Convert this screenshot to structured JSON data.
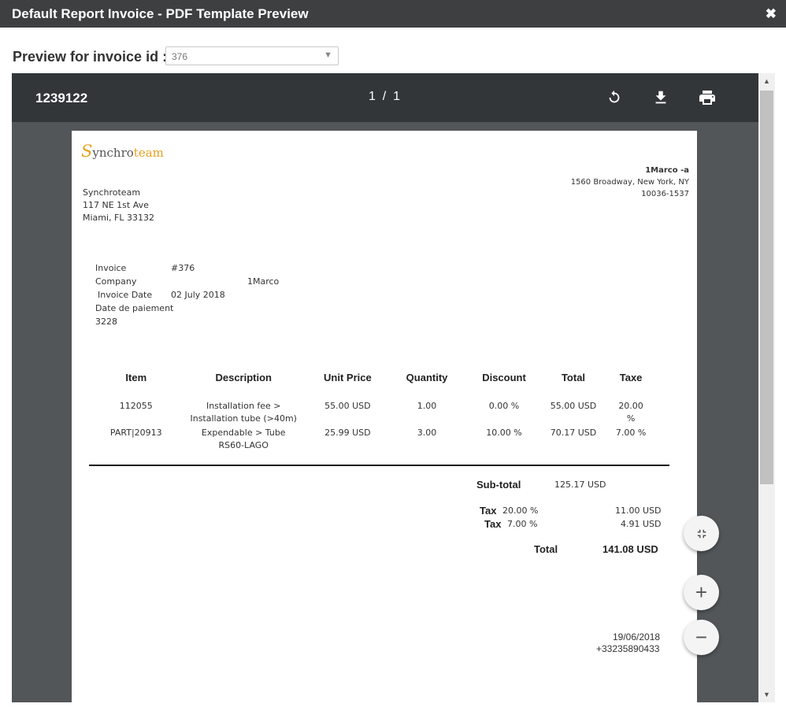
{
  "dialog": {
    "title": "Default Report Invoice - PDF Template Preview",
    "close_glyph": "✖"
  },
  "selector": {
    "label": "Preview for invoice id :",
    "value": "376"
  },
  "viewer": {
    "doc_name": "1239122",
    "page_current": "1",
    "page_sep": "/",
    "page_total": "1",
    "icons": [
      "rotate-icon",
      "download-icon",
      "print-icon"
    ]
  },
  "invoice": {
    "logo_first": "S",
    "logo_mid": "ynchro",
    "logo_end": "team",
    "client": {
      "name": "1Marco -a",
      "address1": "1560 Broadway, New York, NY",
      "address2": "10036-1537"
    },
    "company": {
      "name": "Synchroteam",
      "address1": "117 NE 1st Ave",
      "address2": "Miami, FL 33132"
    },
    "meta": {
      "invoice_label": "Invoice",
      "invoice_value": "#376",
      "company_label": "Company",
      "company_value": "1Marco",
      "date_label": "Invoice Date",
      "date_value": "02 July 2018",
      "payment_label": "Date de paiement",
      "payment_value": "3228"
    },
    "columns": [
      "Item",
      "Description",
      "Unit Price",
      "Quantity",
      "Discount",
      "Total",
      "Taxe"
    ],
    "rows": [
      {
        "item": "112055",
        "desc1": "Installation fee >",
        "desc2": "Installation tube (>40m)",
        "unit_price": "55.00 USD",
        "quantity": "1.00",
        "discount": "0.00 %",
        "total": "55.00 USD",
        "taxe": "20.00 %"
      },
      {
        "item": "PART|20913",
        "desc1": "Expendable > Tube",
        "desc2": "RS60-LAGO",
        "unit_price": "25.99 USD",
        "quantity": "3.00",
        "discount": "10.00 %",
        "total": "70.17 USD",
        "taxe": "7.00 %"
      }
    ],
    "subtotal_label": "Sub-total",
    "subtotal_value": "125.17 USD",
    "taxes": [
      {
        "label": "Tax",
        "rate": "20.00 %",
        "amount": "11.00 USD"
      },
      {
        "label": "Tax",
        "rate": "7.00 %",
        "amount": "4.91 USD"
      }
    ],
    "total_label": "Total",
    "total_value": "141.08 USD",
    "footer_date": "19/06/2018",
    "footer_phone": "+33235890433"
  },
  "controls": {
    "fit_icon": "fit-page-icon",
    "zoom_in": "+",
    "zoom_out": "−"
  },
  "colors": {
    "titlebar": "#3d3f40",
    "toolbar": "#323639",
    "viewer_bg": "#525659",
    "brand_accent": "#e8a020"
  }
}
